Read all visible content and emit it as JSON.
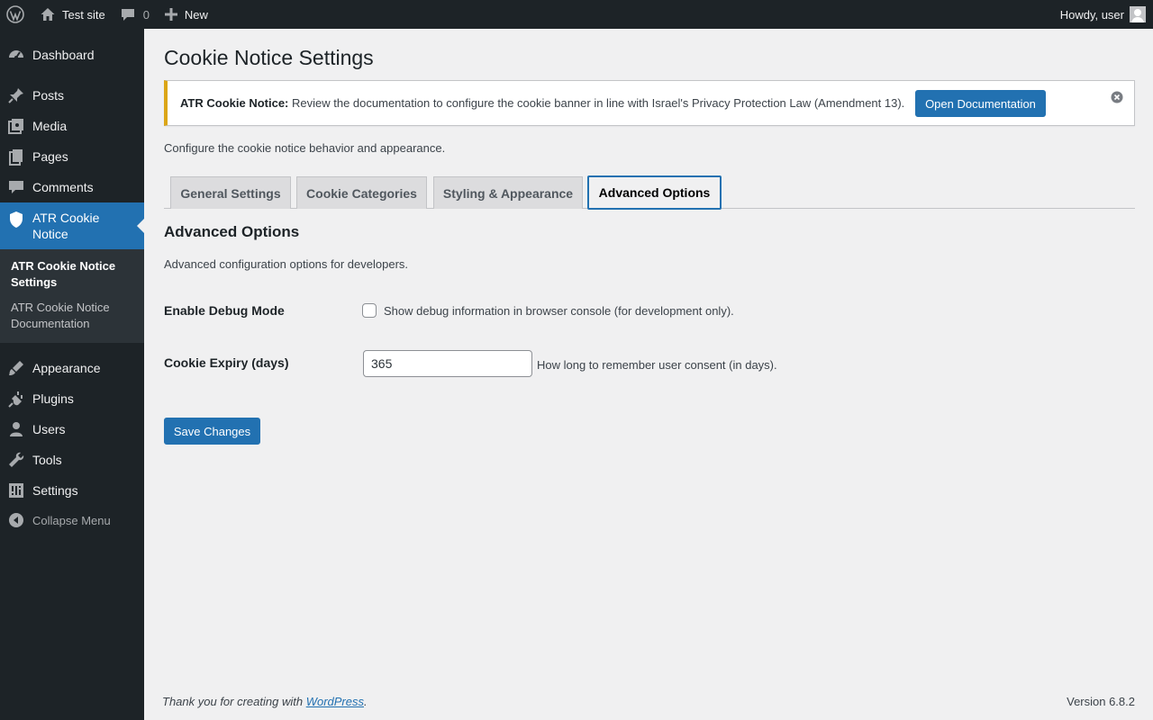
{
  "adminbar": {
    "site_name": "Test site",
    "comments_count": "0",
    "new_label": "New",
    "greeting": "Howdy, user"
  },
  "sidebar": {
    "items": [
      {
        "label": "Dashboard",
        "icon": "dashboard-icon"
      },
      {
        "label": "Posts",
        "icon": "pin-icon"
      },
      {
        "label": "Media",
        "icon": "media-icon"
      },
      {
        "label": "Pages",
        "icon": "pages-icon"
      },
      {
        "label": "Comments",
        "icon": "comment-icon"
      },
      {
        "label": "ATR Cookie Notice",
        "icon": "shield-icon"
      },
      {
        "label": "Appearance",
        "icon": "brush-icon"
      },
      {
        "label": "Plugins",
        "icon": "plugin-icon"
      },
      {
        "label": "Users",
        "icon": "user-icon"
      },
      {
        "label": "Tools",
        "icon": "wrench-icon"
      },
      {
        "label": "Settings",
        "icon": "settings-icon"
      }
    ],
    "submenu": [
      "ATR Cookie Notice Settings",
      "ATR Cookie Notice Documentation"
    ],
    "collapse_label": "Collapse Menu"
  },
  "page": {
    "title": "Cookie Notice Settings",
    "notice": {
      "strong": "ATR Cookie Notice:",
      "text": " Review the documentation to configure the cookie banner in line with Israel's Privacy Protection Law (Amendment 13).",
      "button": "Open Documentation"
    },
    "description": "Configure the cookie notice behavior and appearance.",
    "tabs": [
      "General Settings",
      "Cookie Categories",
      "Styling & Appearance",
      "Advanced Options"
    ],
    "active_tab": "Advanced Options",
    "section_title": "Advanced Options",
    "section_desc": "Advanced configuration options for developers.",
    "debug": {
      "label": "Enable Debug Mode",
      "checkbox_text": "Show debug information in browser console (for development only).",
      "checked": false
    },
    "expiry": {
      "label": "Cookie Expiry (days)",
      "value": "365",
      "desc": "How long to remember user consent (in days)."
    },
    "save_label": "Save Changes"
  },
  "footer": {
    "thanks_prefix": "Thank you for creating with ",
    "thanks_link": "WordPress",
    "thanks_suffix": ".",
    "version": "Version 6.8.2"
  },
  "colors": {
    "accent": "#2271b1",
    "sidebar_bg": "#1d2327",
    "notice_border": "#dba617"
  }
}
